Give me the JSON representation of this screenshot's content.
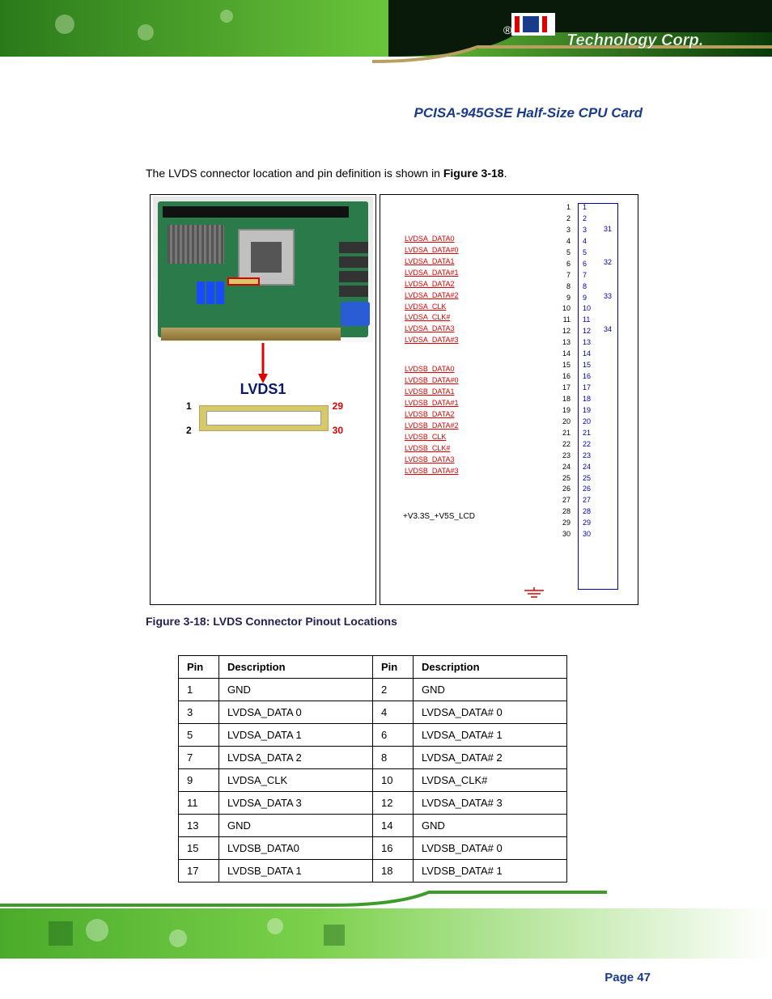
{
  "page": {
    "title": "PCISA-945GSE Half-Size CPU Card",
    "intro_1": "The LVDS connector location and pin definition is shown in ",
    "intro_bold": "Figure 3-18",
    "intro_2": ".",
    "figure_caption": "Figure 3-18: LVDS Connector Pinout Locations",
    "page_number": "Page 47"
  },
  "brand": "Technology Corp.",
  "connector_label": "LVDS1",
  "connector_pins": {
    "p1": "1",
    "p2": "2",
    "p29": "29",
    "p30": "30"
  },
  "voltage_label": "+V3.3S_+V5S_LCD",
  "schematic_labels_a": [
    "LVDSA_DATA0",
    "LVDSA_DATA#0",
    "LVDSA_DATA1",
    "LVDSA_DATA#1",
    "LVDSA_DATA2",
    "LVDSA_DATA#2",
    "LVDSA_CLK",
    "LVDSA_CLK#",
    "LVDSA_DATA3",
    "LVDSA_DATA#3"
  ],
  "schematic_labels_b": [
    "LVDSB_DATA0",
    "LVDSB_DATA#0",
    "LVDSB_DATA1",
    "LVDSB_DATA#1",
    "LVDSB_DATA2",
    "LVDSB_DATA#2",
    "LVDSB_CLK",
    "LVDSB_CLK#",
    "LVDSB_DATA3",
    "LVDSB_DATA#3"
  ],
  "pin_numbers_left": [
    "1",
    "2",
    "3",
    "4",
    "5",
    "6",
    "7",
    "8",
    "9",
    "10",
    "11",
    "12",
    "13",
    "14",
    "15",
    "16",
    "17",
    "18",
    "19",
    "20",
    "21",
    "22",
    "23",
    "24",
    "25",
    "26",
    "27",
    "28",
    "29",
    "30"
  ],
  "pin_numbers_right": [
    "1",
    "2",
    "3",
    "4",
    "5",
    "6",
    "7",
    "8",
    "9",
    "10",
    "11",
    "12",
    "13",
    "14",
    "15",
    "16",
    "17",
    "18",
    "19",
    "20",
    "21",
    "22",
    "23",
    "24",
    "25",
    "26",
    "27",
    "28",
    "29",
    "30"
  ],
  "pin_numbers_far": [
    "31",
    "32",
    "33",
    "34"
  ],
  "table": {
    "headers": [
      "Pin",
      "Description",
      "Pin",
      "Description"
    ],
    "rows": [
      [
        "1",
        "GND",
        "2",
        "GND"
      ],
      [
        "3",
        "LVDSA_DATA 0",
        "4",
        "LVDSA_DATA# 0"
      ],
      [
        "5",
        "LVDSA_DATA 1",
        "6",
        "LVDSA_DATA# 1"
      ],
      [
        "7",
        "LVDSA_DATA 2",
        "8",
        "LVDSA_DATA# 2"
      ],
      [
        "9",
        "LVDSA_CLK",
        "10",
        "LVDSA_CLK#"
      ],
      [
        "11",
        "LVDSA_DATA 3",
        "12",
        "LVDSA_DATA# 3"
      ],
      [
        "13",
        "GND",
        "14",
        "GND"
      ],
      [
        "15",
        "LVDSB_DATA0",
        "16",
        "LVDSB_DATA# 0"
      ],
      [
        "17",
        "LVDSB_DATA 1",
        "18",
        "LVDSB_DATA# 1"
      ]
    ]
  }
}
